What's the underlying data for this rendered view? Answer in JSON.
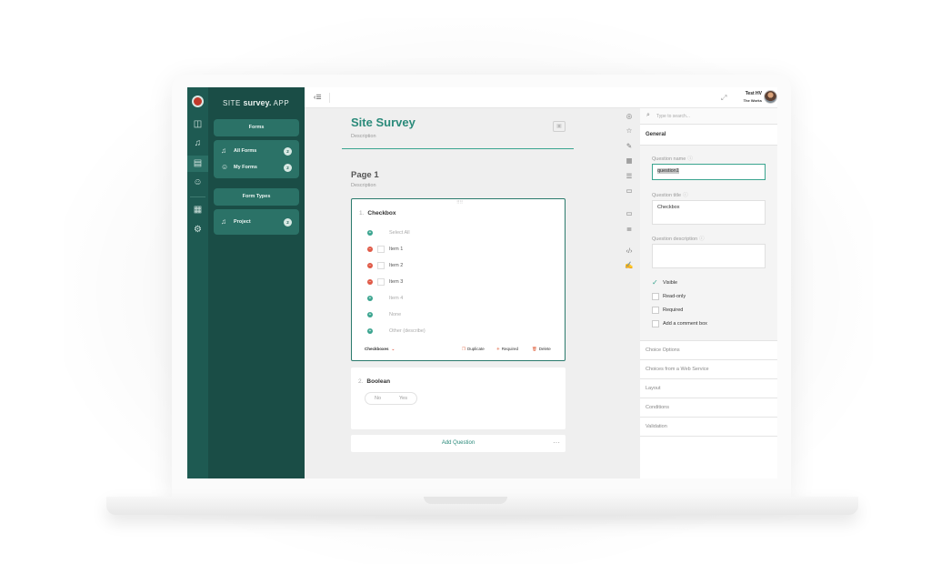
{
  "app": {
    "brand_prefix": "SITE",
    "brand_main": "survey.",
    "brand_suffix": "APP"
  },
  "colors": {
    "rail": "#1e5a52",
    "sidebar": "#1a4d46",
    "sidebar_button": "#2b7267",
    "accent": "#2a8a7a",
    "danger": "#e05a47"
  },
  "rail_icons": [
    "logo-icon",
    "dashboard-icon",
    "bell-icon",
    "clipboard-icon",
    "users-icon",
    "calendar-icon",
    "gear-icon"
  ],
  "sidebar": {
    "forms_header": "Forms",
    "all_forms": {
      "label": "All Forms",
      "count": "2"
    },
    "my_forms": {
      "label": "My Forms",
      "count": "2"
    },
    "form_types_header": "Form Types",
    "project": {
      "label": "Project",
      "count": "2"
    }
  },
  "topbar": {
    "user_name": "Test HV",
    "user_org": "The Works"
  },
  "survey": {
    "title": "Site Survey",
    "description": "Description",
    "page_title": "Page 1",
    "page_description": "Description"
  },
  "checkbox_question": {
    "number": "1.",
    "title": "Checkbox",
    "choices": [
      {
        "label": "Select All",
        "action": "add"
      },
      {
        "label": "Item 1",
        "action": "remove"
      },
      {
        "label": "Item 2",
        "action": "remove"
      },
      {
        "label": "Item 3",
        "action": "remove"
      },
      {
        "label": "Item 4",
        "action": "add"
      },
      {
        "label": "None",
        "action": "add"
      },
      {
        "label": "Other (describe)",
        "action": "add"
      }
    ],
    "type_label": "Checkboxes",
    "duplicate": "Duplicate",
    "required": "Required",
    "delete": "Delete"
  },
  "boolean_question": {
    "number": "2.",
    "title": "Boolean",
    "no": "No",
    "yes": "Yes"
  },
  "add_question": "Add Question",
  "toolstrip_icons": [
    "target-icon",
    "star-icon",
    "edit-icon",
    "calendar-icon",
    "stack-icon",
    "folder-icon",
    "input-icon",
    "text-icon",
    "code-icon",
    "signature-icon"
  ],
  "properties": {
    "search_placeholder": "Type to search...",
    "general": "General",
    "question_name_label": "Question name",
    "question_name_value": "question1",
    "question_title_label": "Question title",
    "question_title_value": "Checkbox",
    "question_description_label": "Question description",
    "question_description_value": "",
    "visible": "Visible",
    "read_only": "Read-only",
    "required": "Required",
    "comment_box": "Add a comment box",
    "sections": [
      "Choice Options",
      "Choices from a Web Service",
      "Layout",
      "Conditions",
      "Validation"
    ]
  }
}
